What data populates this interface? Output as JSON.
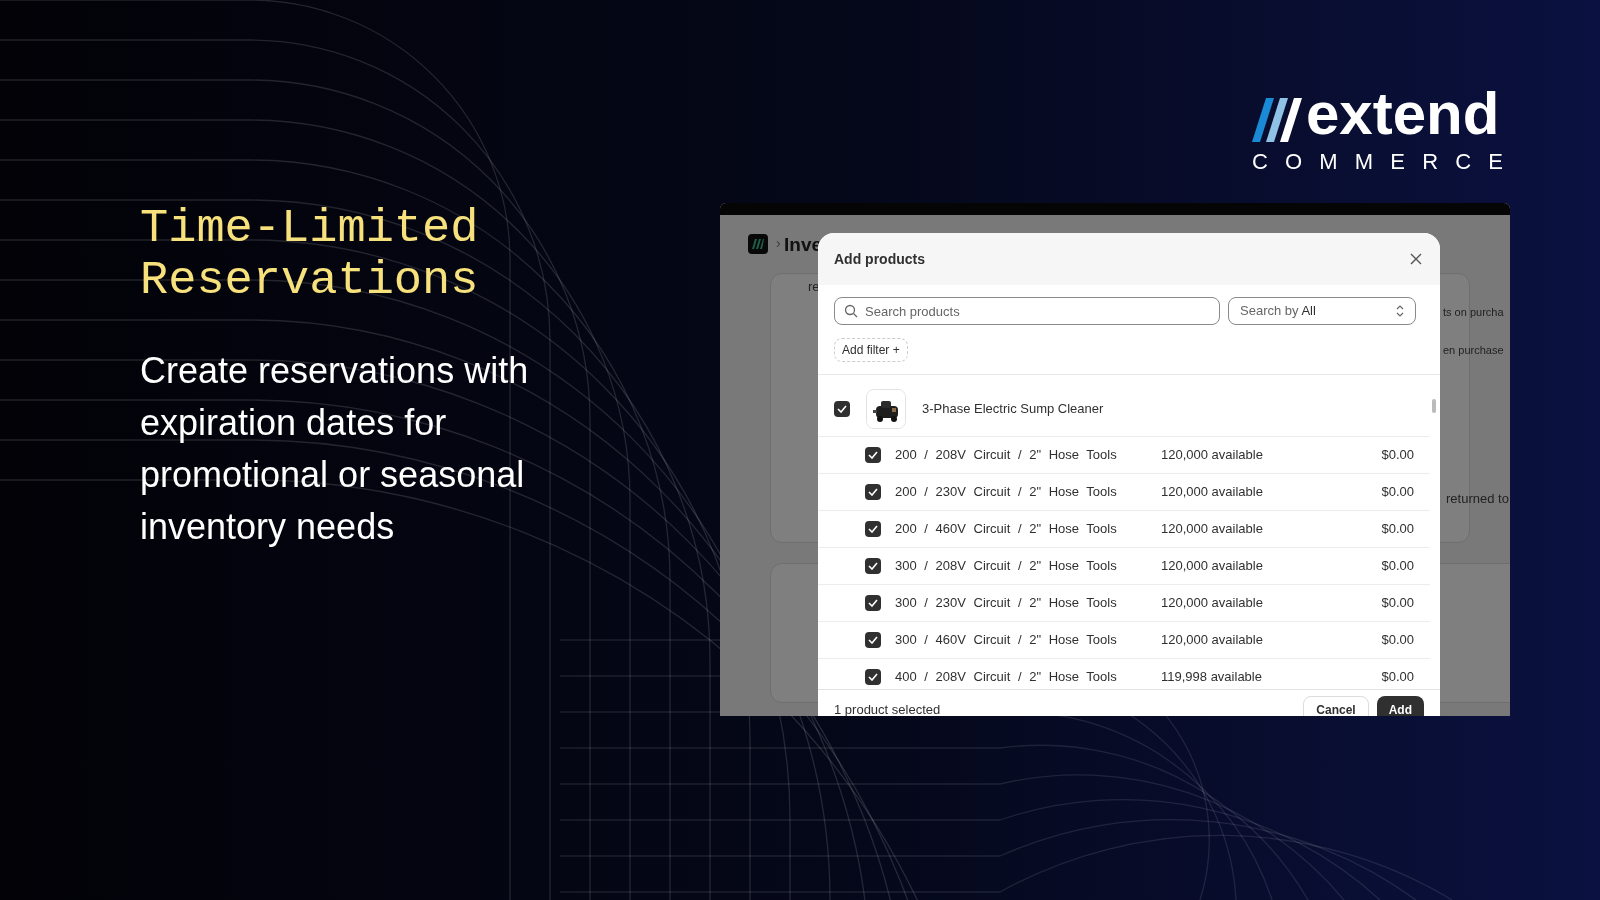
{
  "brand": {
    "name": "extend",
    "sub": "COMMERCE"
  },
  "headline": "Time-Limited Reservations",
  "description": "Create reservations with expiration dates for promotional or seasonal inventory needs",
  "app": {
    "separator": "›",
    "breadcrumb": "Inve",
    "background_texts": [
      "re",
      "ts on purcha",
      "en purchase",
      "returned to"
    ]
  },
  "dialog": {
    "title": "Add products",
    "search": {
      "placeholder": "Search products"
    },
    "search_by": {
      "label": "Search by",
      "value": "All"
    },
    "add_filter": "Add filter +",
    "product": {
      "name": "3-Phase Electric Sump Cleaner",
      "checked": true,
      "variants": [
        {
          "label": "200 / 208V Circuit / 2\" Hose Tools",
          "available": "120,000 available",
          "price": "$0.00",
          "checked": true
        },
        {
          "label": "200 / 230V Circuit / 2\" Hose Tools",
          "available": "120,000 available",
          "price": "$0.00",
          "checked": true
        },
        {
          "label": "200 / 460V Circuit / 2\" Hose Tools",
          "available": "120,000 available",
          "price": "$0.00",
          "checked": true
        },
        {
          "label": "300 / 208V Circuit / 2\" Hose Tools",
          "available": "120,000 available",
          "price": "$0.00",
          "checked": true
        },
        {
          "label": "300 / 230V Circuit / 2\" Hose Tools",
          "available": "120,000 available",
          "price": "$0.00",
          "checked": true
        },
        {
          "label": "300 / 460V Circuit / 2\" Hose Tools",
          "available": "120,000 available",
          "price": "$0.00",
          "checked": true
        },
        {
          "label": "400 / 208V Circuit / 2\" Hose Tools",
          "available": "119,998 available",
          "price": "$0.00",
          "checked": true
        }
      ]
    },
    "footer": {
      "status": "1 product selected",
      "buttons": [
        {
          "label": "Cancel",
          "kind": "secondary"
        },
        {
          "label": "Add",
          "kind": "primary"
        }
      ]
    }
  }
}
